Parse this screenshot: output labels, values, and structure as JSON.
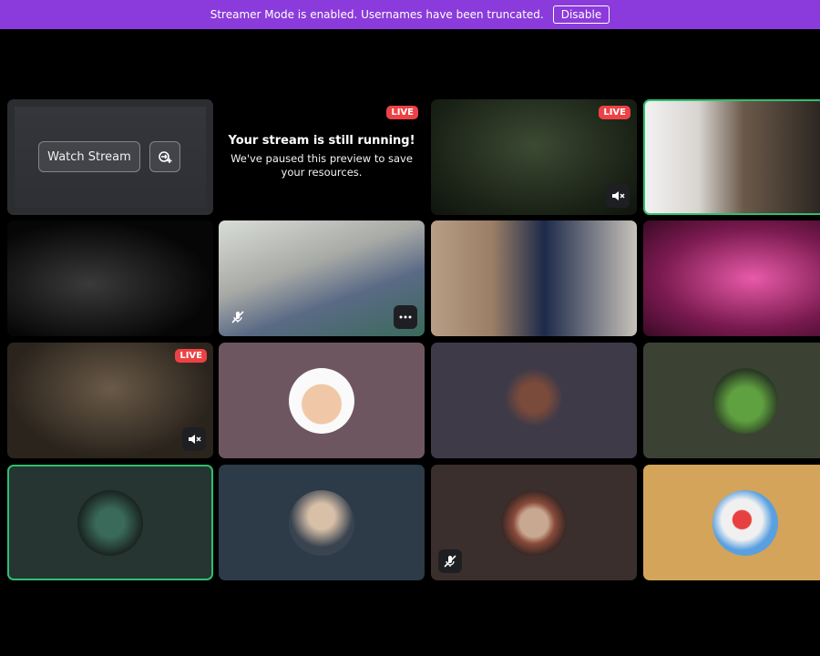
{
  "banner": {
    "message": "Streamer Mode is enabled. Usernames have been truncated.",
    "disable_label": "Disable",
    "color": "#8b3bdb"
  },
  "stream_tile": {
    "watch_label": "Watch Stream",
    "popout_icon": "popout-icon"
  },
  "paused": {
    "live_label": "LIVE",
    "title": "Your stream is still running!",
    "subtitle": "We've paused this preview to save your resources."
  },
  "live_label": "LIVE",
  "colors": {
    "speaking_border": "#2fbf71",
    "live_badge": "#ed4245",
    "tile_mauve": "#6e5660",
    "tile_slate": "#3e3a48",
    "tile_olive": "#3b4234",
    "tile_darkgreen": "#263531",
    "tile_blue": "#2d3a47",
    "tile_brown": "#3a2f2d",
    "tile_gold": "#d3a45a"
  },
  "icons": [
    "mute-icon",
    "deafen-icon",
    "more-icon",
    "popout-icon"
  ]
}
